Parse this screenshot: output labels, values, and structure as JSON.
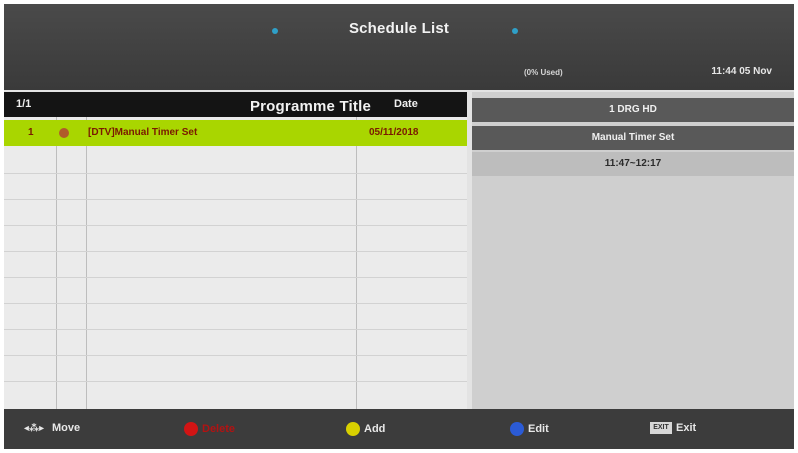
{
  "header": {
    "title": "Schedule List",
    "status_used": "(0% Used)",
    "clock": "11:44 05 Nov"
  },
  "table": {
    "columns": [
      "1/1",
      "Programme Title",
      "Date"
    ],
    "rows": [
      {
        "index": "1",
        "title": "[DTV]Manual Timer Set",
        "date": "05/11/2018"
      }
    ]
  },
  "details": {
    "channel": "1 DRG HD",
    "mode": "Manual Timer Set",
    "time": "11:47~12:17"
  },
  "footer": {
    "move": "Move",
    "delete": "Delete",
    "add": "Add",
    "edit": "Edit",
    "exit": "Exit",
    "exit_key": "EXIT",
    "move_glyph": "◂⁂▸"
  },
  "colors": {
    "selected_row": "#a9d600",
    "header_bar": "#141414",
    "footer_bar": "#3c3c3c",
    "red_button": "#d21414",
    "yellow_button": "#d8d000",
    "blue_button": "#2b5bd6",
    "accent_dot": "#2fa0c8"
  }
}
